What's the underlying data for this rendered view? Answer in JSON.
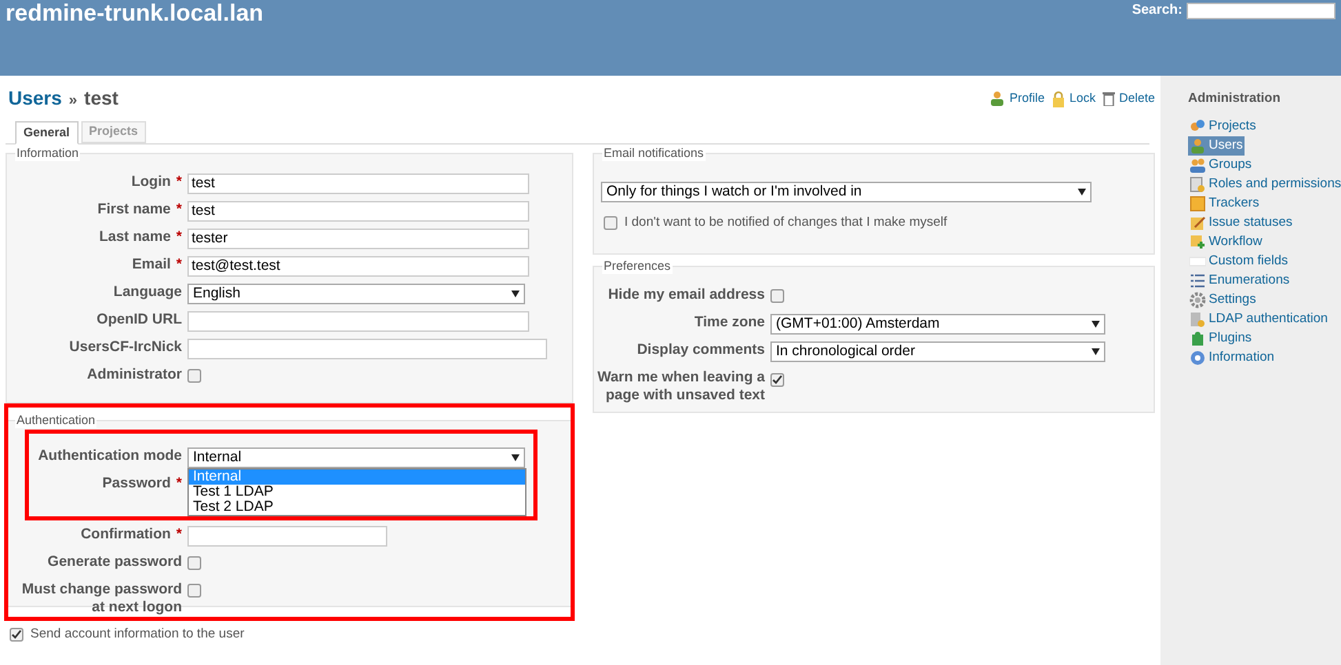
{
  "header": {
    "site_title": "redmine-trunk.local.lan",
    "search_label": "Search:"
  },
  "page_title": {
    "parent": "Users",
    "separator": "»",
    "name": "test"
  },
  "actions": [
    {
      "label": "Profile",
      "kind": "profile"
    },
    {
      "label": "Lock",
      "kind": "lock"
    },
    {
      "label": "Delete",
      "kind": "delete"
    }
  ],
  "tabs": [
    {
      "label": "General",
      "selected": true
    },
    {
      "label": "Projects",
      "selected": false
    }
  ],
  "information": {
    "legend": "Information",
    "fields": [
      {
        "label": "Login",
        "required_mark": "*",
        "kind": "text",
        "value": "test"
      },
      {
        "label": "First name",
        "required_mark": "*",
        "kind": "text",
        "value": "test"
      },
      {
        "label": "Last name",
        "required_mark": "*",
        "kind": "text",
        "value": "tester"
      },
      {
        "label": "Email",
        "required_mark": "*",
        "kind": "text",
        "value": "test@test.test"
      },
      {
        "label": "Language",
        "kind": "select",
        "value": "English"
      },
      {
        "label": "OpenID URL",
        "kind": "text"
      },
      {
        "label": "UsersCF-IrcNick",
        "kind": "text"
      },
      {
        "label": "Administrator",
        "kind": "checkbox",
        "checked": false
      }
    ]
  },
  "authentication": {
    "legend": "Authentication",
    "fields": [
      {
        "label": "Authentication mode",
        "kind": "select",
        "value": "Internal"
      },
      {
        "label": "Password",
        "required_mark": "*",
        "kind": "hidden"
      },
      {
        "label": "Confirmation",
        "required_mark": "*",
        "kind": "text"
      },
      {
        "label": "Generate password",
        "kind": "checkbox",
        "checked": false
      },
      {
        "label": "Must change password at next logon",
        "kind": "checkbox",
        "checked": false
      }
    ],
    "dropdown_options": [
      {
        "label": "Internal",
        "selected": true
      },
      {
        "label": "Test 1 LDAP",
        "selected": false
      },
      {
        "label": "Test 2 LDAP",
        "selected": false
      }
    ]
  },
  "send_account_info": {
    "label": "Send account information to the user",
    "checked": true
  },
  "email_notifications": {
    "legend": "Email notifications",
    "value": "Only for things I watch or I'm involved in",
    "option": {
      "label": "I don't want to be notified of changes that I make myself",
      "checked": false
    }
  },
  "preferences": {
    "legend": "Preferences",
    "fields": [
      {
        "label": "Hide my email address",
        "kind": "checkbox",
        "checked": false
      },
      {
        "label": "Time zone",
        "kind": "select",
        "value": "(GMT+01:00) Amsterdam"
      },
      {
        "label": "Display comments",
        "kind": "select",
        "value": "In chronological order"
      },
      {
        "label": "Warn me when leaving a page with unsaved text",
        "kind": "checkbox",
        "checked": true
      }
    ]
  },
  "sidebar": {
    "title": "Administration",
    "items": [
      {
        "label": "Projects",
        "selected": false
      },
      {
        "label": "Users",
        "selected": true
      },
      {
        "label": "Groups",
        "selected": false
      },
      {
        "label": "Roles and permissions",
        "selected": false
      },
      {
        "label": "Trackers",
        "selected": false
      },
      {
        "label": "Issue statuses",
        "selected": false
      },
      {
        "label": "Workflow",
        "selected": false
      },
      {
        "label": "Custom fields",
        "selected": false
      },
      {
        "label": "Enumerations",
        "selected": false
      },
      {
        "label": "Settings",
        "selected": false
      },
      {
        "label": "LDAP authentication",
        "selected": false
      },
      {
        "label": "Plugins",
        "selected": false
      },
      {
        "label": "Information",
        "selected": false
      }
    ]
  }
}
